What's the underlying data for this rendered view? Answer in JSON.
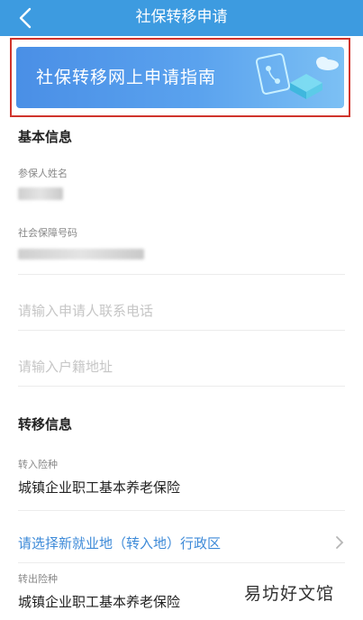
{
  "header": {
    "title": "社保转移申请",
    "back_icon": "back-arrow-icon"
  },
  "banner": {
    "text": "社保转移网上申请指南",
    "highlight_color": "#d0342c"
  },
  "basic_info": {
    "section_title": "基本信息",
    "name_label": "参保人姓名",
    "ssn_label": "社会保障号码",
    "phone_placeholder": "请输入申请人联系电话",
    "address_placeholder": "请输入户籍地址"
  },
  "transfer_info": {
    "section_title": "转移信息",
    "in_insurance_label": "转入险种",
    "in_insurance_value": "城镇企业职工基本养老保险",
    "region_link": "请选择新就业地（转入地）行政区",
    "out_insurance_label": "转出险种",
    "out_insurance_value": "城镇企业职工基本养老保险"
  },
  "watermark": "易坊好文馆",
  "colors": {
    "header": "#3d9be0",
    "link": "#3d8ad8"
  }
}
